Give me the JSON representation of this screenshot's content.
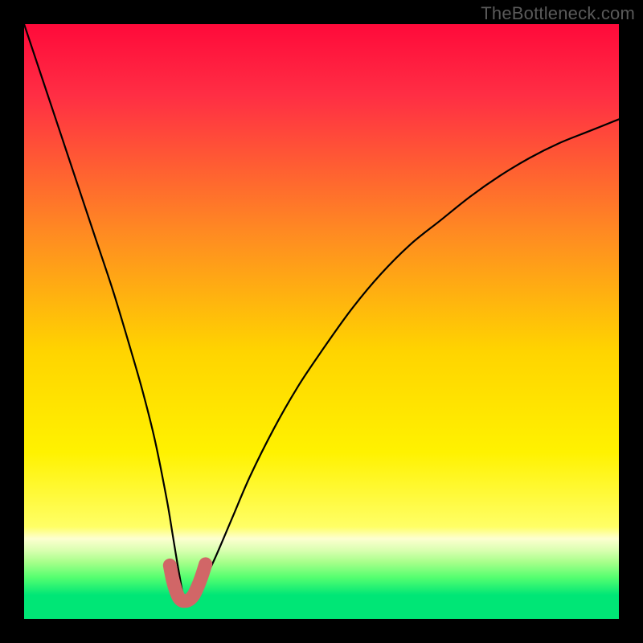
{
  "watermark": "TheBottleneck.com",
  "colors": {
    "frame": "#000000",
    "curve": "#000000",
    "marker": "#d16667",
    "gradient_stops": [
      {
        "offset": 0.0,
        "color": "#ff0a3a"
      },
      {
        "offset": 0.12,
        "color": "#ff2e44"
      },
      {
        "offset": 0.35,
        "color": "#ff8a22"
      },
      {
        "offset": 0.55,
        "color": "#ffd400"
      },
      {
        "offset": 0.72,
        "color": "#fff200"
      },
      {
        "offset": 0.845,
        "color": "#ffff66"
      },
      {
        "offset": 0.865,
        "color": "#fdffd0"
      },
      {
        "offset": 0.885,
        "color": "#d9ffb0"
      },
      {
        "offset": 0.905,
        "color": "#a6ff8a"
      },
      {
        "offset": 0.93,
        "color": "#56ff70"
      },
      {
        "offset": 0.96,
        "color": "#00e676"
      },
      {
        "offset": 1.0,
        "color": "#00e676"
      }
    ]
  },
  "chart_data": {
    "type": "line",
    "title": "",
    "xlabel": "",
    "ylabel": "",
    "xlim": [
      0,
      100
    ],
    "ylim": [
      0,
      100
    ],
    "x_minimum": 27,
    "series": [
      {
        "name": "bottleneck-curve",
        "x": [
          0,
          3,
          6,
          9,
          12,
          15,
          18,
          20,
          22,
          24,
          25,
          26,
          27,
          28,
          29,
          30,
          32,
          35,
          38,
          42,
          46,
          50,
          55,
          60,
          65,
          70,
          75,
          80,
          85,
          90,
          95,
          100
        ],
        "y": [
          100,
          91,
          82,
          73,
          64,
          55,
          45,
          38,
          30,
          20,
          14,
          8,
          3,
          3,
          4,
          6,
          10,
          17,
          24,
          32,
          39,
          45,
          52,
          58,
          63,
          67,
          71,
          74.5,
          77.5,
          80,
          82,
          84
        ]
      }
    ],
    "marker_region": {
      "name": "valley-marker",
      "x": [
        24.5,
        25,
        25.5,
        26,
        26.5,
        27,
        27.5,
        28,
        28.5,
        29,
        29.5,
        30,
        30.5
      ],
      "y": [
        9,
        6.5,
        4.8,
        3.6,
        3.1,
        3,
        3.1,
        3.4,
        4.0,
        5.0,
        6.2,
        7.6,
        9.2
      ]
    }
  }
}
